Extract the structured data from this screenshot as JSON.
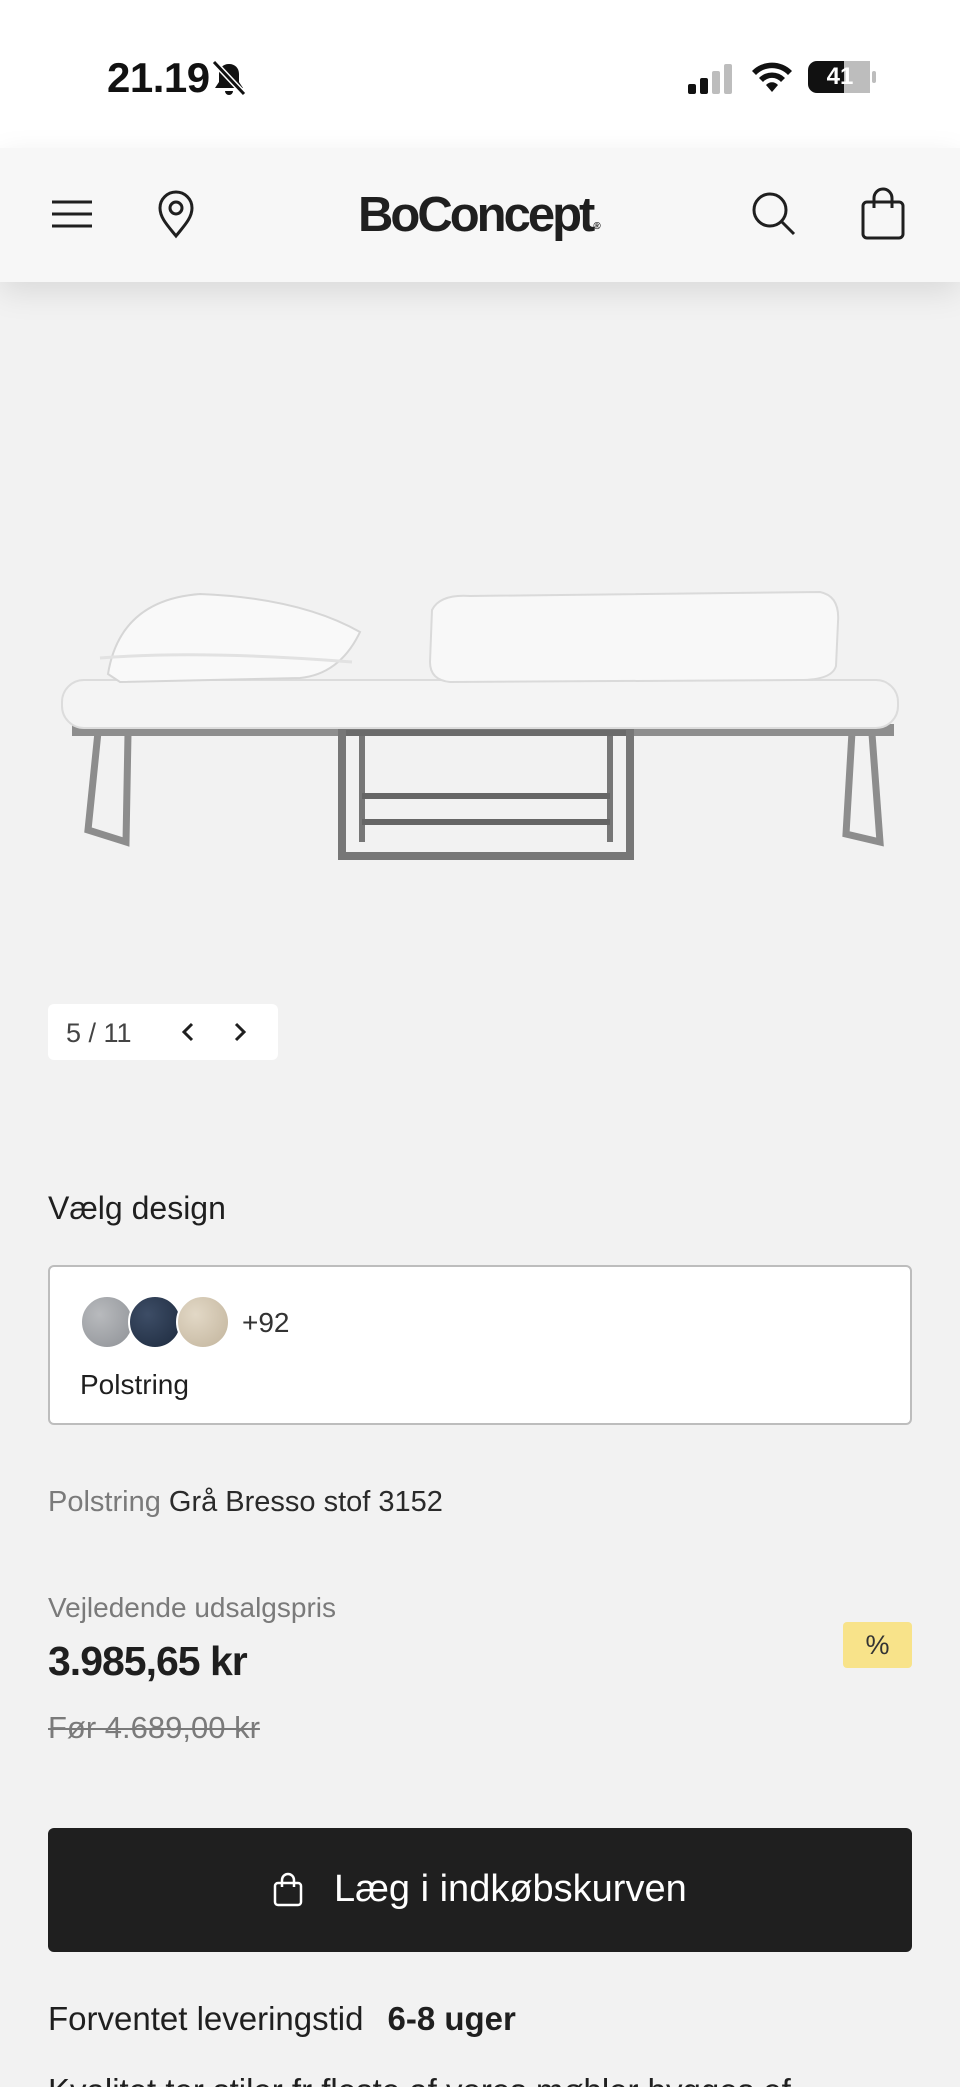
{
  "status_bar": {
    "time": "21.19",
    "battery": "41"
  },
  "header": {
    "logo": "BoConcept",
    "logo_mark": "®"
  },
  "gallery": {
    "pager": "5 / 11"
  },
  "design": {
    "title": "Vælg design",
    "more_count": "+92",
    "label": "Polstring",
    "swatch_colors": [
      "#a4a7ab",
      "#2a3850",
      "#d1c5b0"
    ]
  },
  "selection": {
    "key": "Polstring",
    "value": "Grå Bresso stof 3152"
  },
  "price": {
    "label": "Vejledende udsalgspris",
    "current": "3.985,65 kr",
    "before": "Før 4.689,00 kr",
    "discount_badge": "%"
  },
  "cart_button": {
    "label": "Læg i indkøbskurven"
  },
  "delivery": {
    "label": "Forventet leveringstid",
    "value": "6-8 uger",
    "cutoff_text": "Kvalitet ter stiler fr fleste af vores møbler bygges ef"
  },
  "colors": {
    "accent": "#1f1f1f",
    "badge": "#f8e38a",
    "background": "#f2f2f2"
  }
}
